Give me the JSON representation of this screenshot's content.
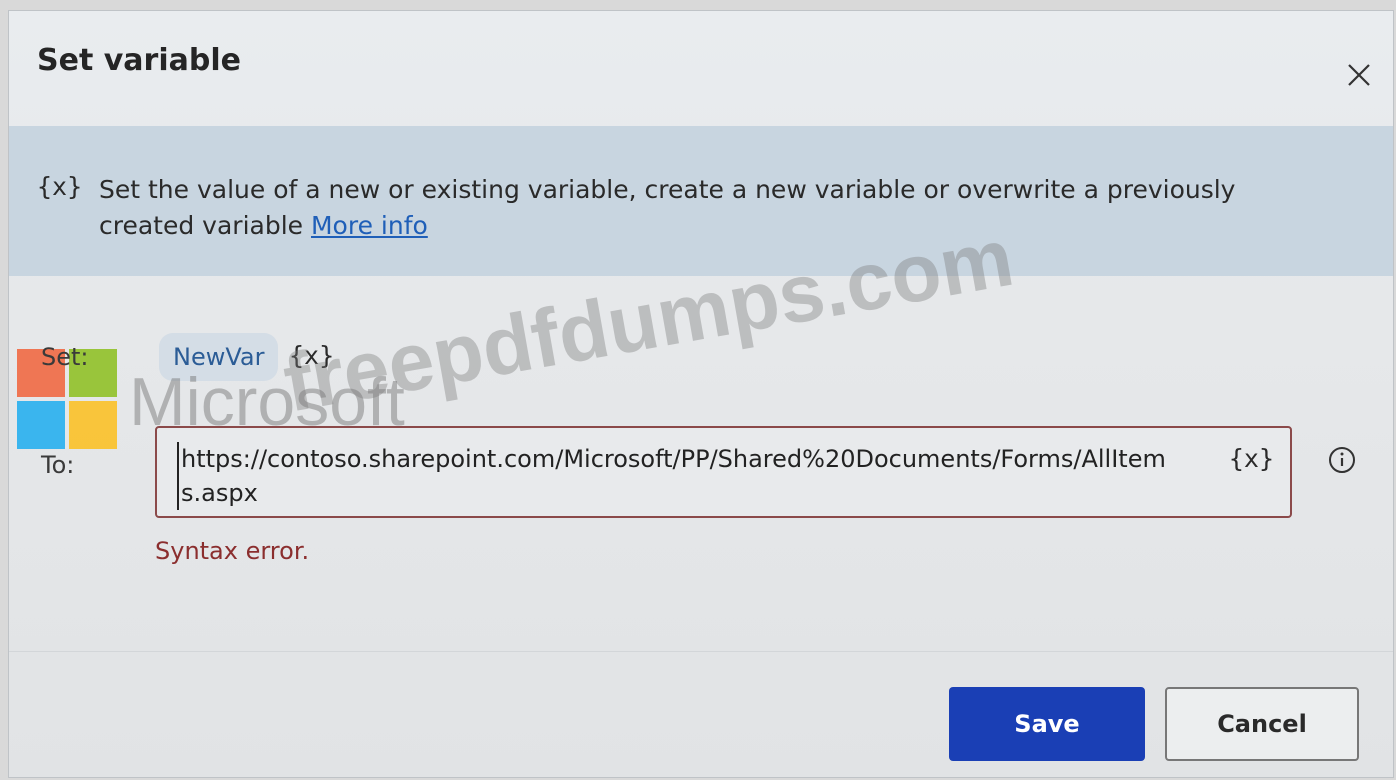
{
  "dialog": {
    "title": "Set variable",
    "close_icon": "close-icon"
  },
  "banner": {
    "icon_text": "{x}",
    "description": "Set the value of a new or existing variable, create a new variable or overwrite a previously created variable",
    "more_info_label": "More info"
  },
  "form": {
    "set_label": "Set:",
    "variable_name": "NewVar",
    "variable_picker": "{x}",
    "to_label": "To:",
    "to_value": "https://contoso.sharepoint.com/Microsoft/PP/Shared%20Documents/Forms/AllItems.aspx",
    "to_variable_picker": "{x}",
    "info_icon": "info-icon",
    "error_text": "Syntax error."
  },
  "footer": {
    "save_label": "Save",
    "cancel_label": "Cancel"
  },
  "watermark": {
    "brand": "Microsoft",
    "site": "freepdfdumps.com"
  },
  "colors": {
    "banner_bg": "#c8d5e0",
    "link": "#1f5fb8",
    "error": "#8b2e2e",
    "primary_button": "#1a3fb5",
    "chip_text": "#2b5c96"
  }
}
